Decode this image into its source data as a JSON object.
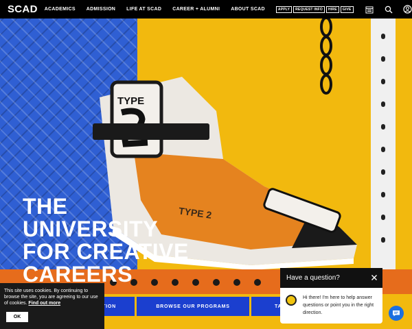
{
  "brand": {
    "logo": "SCAD"
  },
  "nav": {
    "links": [
      "ACADEMICS",
      "ADMISSION",
      "LIFE AT SCAD",
      "CAREER + ALUMNI",
      "ABOUT SCAD"
    ],
    "utility": [
      "APPLY",
      "REQUEST INFO",
      "HIRE",
      "GIVE"
    ],
    "icons": [
      "calendar-icon",
      "search-icon",
      "account-icon"
    ]
  },
  "hero": {
    "headline": [
      "THE",
      "UNIVERSITY",
      "FOR CREATIVE",
      "CAREERS"
    ],
    "colors": {
      "background": "#f2b90e",
      "diamond_plate": "#2f5fd3",
      "rail": "#e66c1c"
    }
  },
  "cta": {
    "left": "ATION",
    "middle": "BROWSE OUR PROGRAMS",
    "right": "TA"
  },
  "cookie": {
    "text": "This site uses cookies. By continuing to browse the site, you are agreeing to our use of cookies.",
    "link": "Find out more",
    "ok": "OK"
  },
  "chat": {
    "title": "Have a question?",
    "message": "Hi there! I'm here to help answer questions or point you in the right direction."
  }
}
